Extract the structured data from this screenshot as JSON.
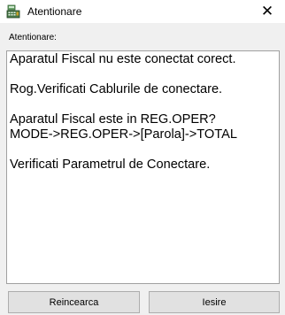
{
  "window": {
    "title": "Atentionare",
    "icon": "cash-register-icon",
    "close_glyph": "✕"
  },
  "group": {
    "label": "Atentionare:"
  },
  "message": {
    "lines": [
      "Aparatul Fiscal nu este conectat corect.",
      "",
      "Rog.Verificati Cablurile de conectare.",
      "",
      "Aparatul Fiscal este in REG.OPER?",
      "MODE->REG.OPER->[Parola]->TOTAL",
      "",
      "Verificati Parametrul de Conectare."
    ]
  },
  "buttons": {
    "retry_label": "Reincearca",
    "exit_label": "Iesire"
  }
}
